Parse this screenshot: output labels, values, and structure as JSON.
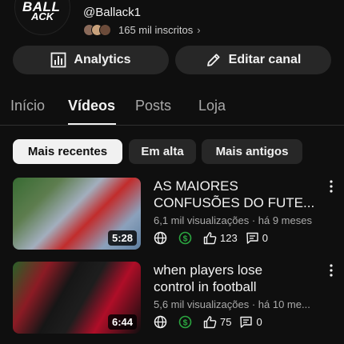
{
  "channel": {
    "logo_line1": "BALL",
    "logo_line2": "ACK",
    "handle": "@Ballack1",
    "subscribers": "165 mil inscritos",
    "subscribers_chevron": "›"
  },
  "actions": {
    "analytics_label": "Analytics",
    "edit_label": "Editar canal"
  },
  "tabs": [
    {
      "label": "Início",
      "active": false
    },
    {
      "label": "Vídeos",
      "active": true
    },
    {
      "label": "Posts",
      "active": false
    },
    {
      "label": "Loja",
      "active": false
    }
  ],
  "chips": [
    {
      "label": "Mais recentes",
      "selected": true
    },
    {
      "label": "Em alta",
      "selected": false
    },
    {
      "label": "Mais antigos",
      "selected": false
    }
  ],
  "videos": [
    {
      "title_line1": "AS MAIORES",
      "title_line2": "CONFUSÕES DO FUTE...",
      "meta": "6,1 mil visualizações · há 9 meses",
      "duration": "5:28",
      "likes": "123",
      "comments": "0"
    },
    {
      "title_line1": "when players lose",
      "title_line2": "control in football",
      "meta": "5,6 mil visualizações · há 10 me...",
      "duration": "6:44",
      "likes": "75",
      "comments": "0"
    }
  ],
  "colors": {
    "background": "#0f0f0f",
    "surface": "#272727",
    "text": "#f1f1f1",
    "secondary_text": "#aaaaaa",
    "monetization_green": "#2ba640"
  }
}
